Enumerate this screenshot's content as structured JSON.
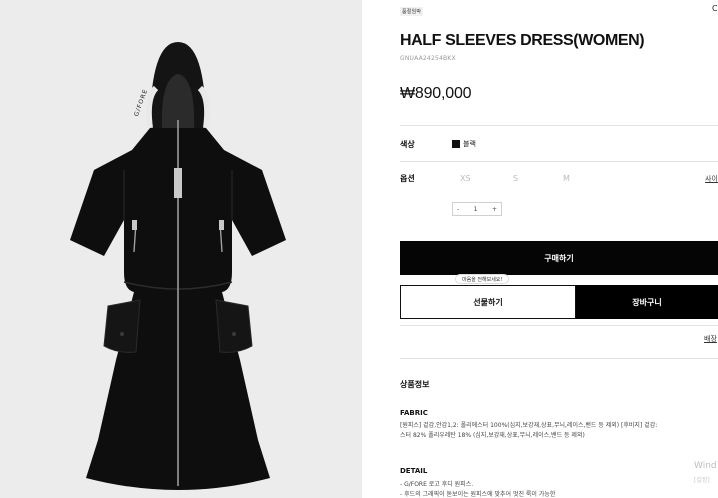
{
  "gallery": {
    "hood_text": "G/FORE"
  },
  "product": {
    "badge": "품절임박",
    "title": "HALF SLEEVES DRESS(WOMEN)",
    "code": "GNUAA24254BKX",
    "price": "₩890,000",
    "corner": "C"
  },
  "options": {
    "color_label": "색상",
    "color_name": "블랙",
    "color_hex": "#111111",
    "option_label": "옵션",
    "sizes": [
      "XS",
      "S",
      "M"
    ],
    "size_guide": "사이",
    "qty_minus": "-",
    "qty_value": "1",
    "qty_plus": "+"
  },
  "actions": {
    "buy": "구매하기",
    "tooltip": "마음을 전해보세요!",
    "gift": "선물하기",
    "cart": "장바구니",
    "shipping_link": "배장"
  },
  "details": {
    "section_title": "상품정보",
    "fabric_title": "FABRIC",
    "fabric_line1": "[원피스] 겉감,안감1,2: 폴리에스터 100%(심지,보강재,상표,무늬,레이스,밴드 등 제외) [후비지] 겉감:",
    "fabric_line2": "스터 82% 폴리우레탄 18% (심지,보강재,상표,무늬,레이스,밴드 등 제외)",
    "detail_title": "DETAIL",
    "detail_line1": "- G/FORE 로고 후디 원피스.",
    "detail_line2": "- 후드의 그래픽이 돋보이는 원피스에 맞추어 멋진 룩이 가능한"
  },
  "watermark": {
    "line1": "Wind",
    "line2": "[설정]"
  }
}
